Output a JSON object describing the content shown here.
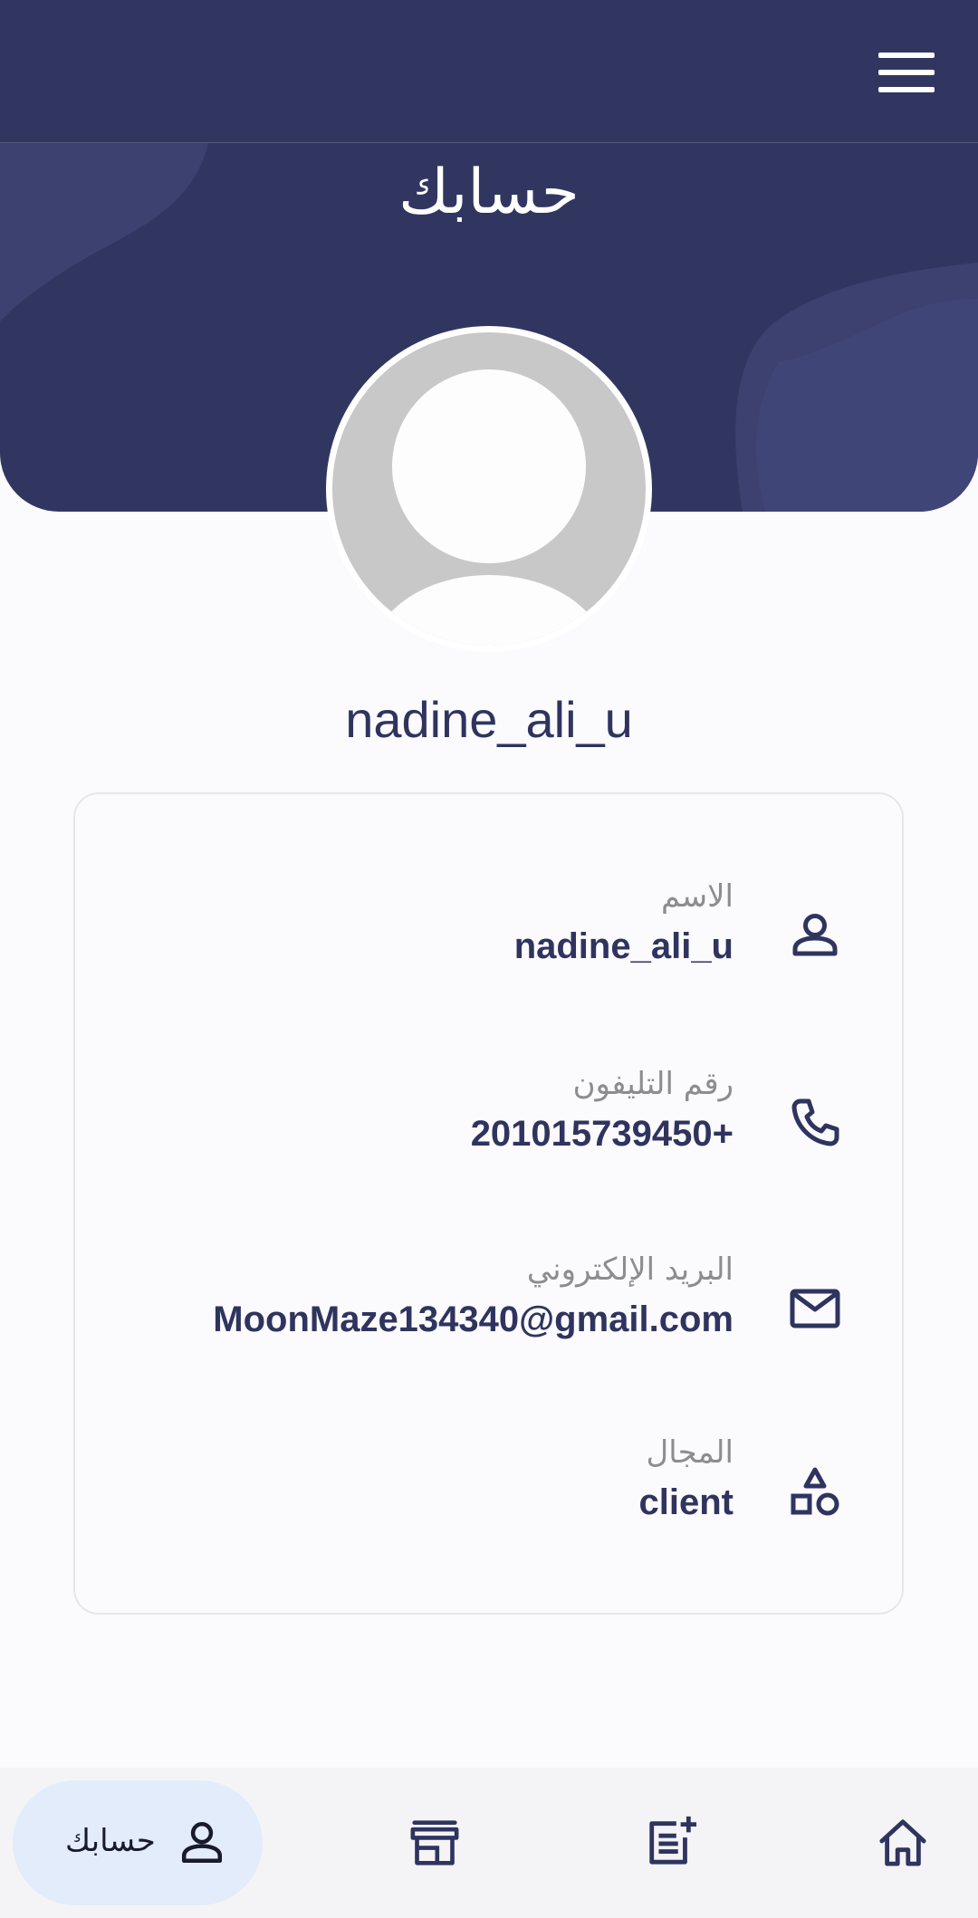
{
  "header": {
    "title": "حسابك",
    "menu_icon": "hamburger-menu-icon",
    "background_color": "#313661"
  },
  "profile": {
    "avatar_icon": "default-avatar-icon",
    "username": "nadine_ali_u"
  },
  "info": {
    "rows": [
      {
        "label": "الاسم",
        "value": "nadine_ali_u",
        "icon": "person-icon"
      },
      {
        "label": "رقم التليفون",
        "value": "201015739450+",
        "icon": "phone-icon"
      },
      {
        "label": "البريد الإلكتروني",
        "value": "MoonMaze134340@gmail.com",
        "icon": "mail-icon"
      },
      {
        "label": "المجال",
        "value": "client",
        "icon": "shapes-icon"
      }
    ]
  },
  "bottom_nav": {
    "active_label": "حسابك",
    "items": [
      {
        "icon": "person-icon",
        "active": true
      },
      {
        "icon": "store-icon",
        "active": false
      },
      {
        "icon": "add-note-icon",
        "active": false
      },
      {
        "icon": "home-icon",
        "active": false
      }
    ],
    "active_color": "#e3ecfa"
  },
  "colors": {
    "primary": "#313661",
    "text_dark": "#2f345f",
    "label_gray": "#8d8d8d"
  }
}
